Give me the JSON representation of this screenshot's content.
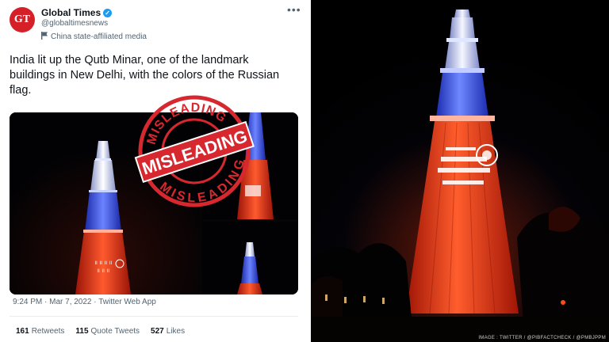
{
  "tweet": {
    "avatar_text": "GT",
    "name": "Global Times",
    "handle": "@globaltimesnews",
    "affiliation": "China state-affiliated media",
    "more": "•••",
    "text": "India lit up the Qutb Minar, one of the landmark buildings in New Delhi, with the colors of the Russian flag.",
    "stamp_main": "MISLEADING",
    "stamp_ring_top": "MISLEADING",
    "stamp_ring_bottom": "MISLEADING",
    "meta": "9:24 PM · Mar 7, 2022 · Twitter Web App",
    "stats": {
      "retweets_count": "161",
      "retweets_label": "Retweets",
      "quotes_count": "115",
      "quotes_label": "Quote Tweets",
      "likes_count": "527",
      "likes_label": "Likes"
    }
  },
  "photo": {
    "credit": "IMAGE : TWITTER / @PIBFACTCHECK / @PMBJPPM"
  },
  "colors": {
    "stamp_red": "#d8282f",
    "tower_white": "#e8eeff",
    "tower_blue": "#3552e0",
    "tower_red": "#e8331d",
    "verified_blue": "#1d9bf0"
  }
}
